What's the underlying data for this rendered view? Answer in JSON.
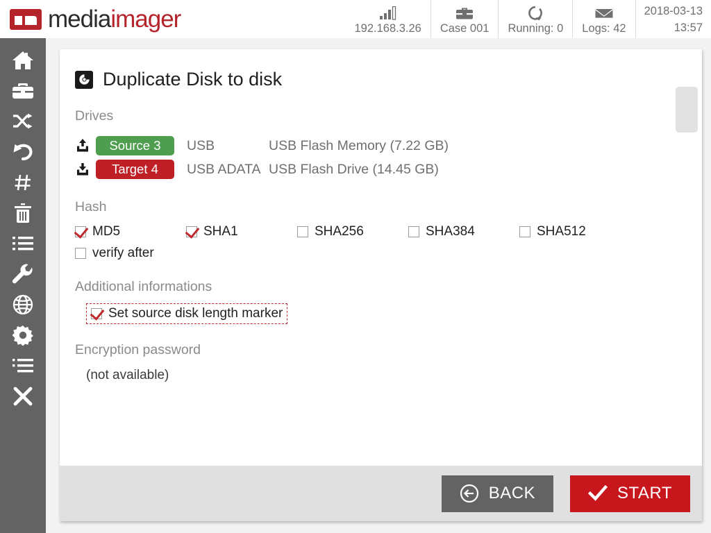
{
  "brand": {
    "name_part1": "media",
    "name_part2": "imager",
    "logo_red": "#b5232b"
  },
  "header": {
    "status": [
      {
        "icon": "signal-bars-icon",
        "label": "192.168.3.26"
      },
      {
        "icon": "briefcase-icon",
        "label": "Case 001"
      },
      {
        "icon": "refresh-icon",
        "label": "Running: 0"
      },
      {
        "icon": "envelope-icon",
        "label": "Logs: 42"
      }
    ],
    "date": "2018-03-13",
    "time": "13:57"
  },
  "sidebar": {
    "items": [
      {
        "icon": "home-icon",
        "name": "home"
      },
      {
        "icon": "briefcase-icon",
        "name": "cases"
      },
      {
        "icon": "shuffle-icon",
        "name": "duplicate"
      },
      {
        "icon": "undo-icon",
        "name": "restore"
      },
      {
        "icon": "hash-icon",
        "name": "hash"
      },
      {
        "icon": "trash-icon",
        "name": "wipe"
      },
      {
        "icon": "list-icon",
        "name": "logs"
      },
      {
        "icon": "wrench-icon",
        "name": "tools"
      },
      {
        "icon": "globe-icon",
        "name": "network"
      },
      {
        "icon": "gear-icon",
        "name": "settings"
      },
      {
        "icon": "indent-list-icon",
        "name": "tasks"
      },
      {
        "icon": "close-x-icon",
        "name": "close"
      }
    ]
  },
  "dialog": {
    "title": "Duplicate Disk to disk",
    "title_icon": "disk-icon",
    "drives_label": "Drives",
    "drives": [
      {
        "direction_icon": "upload-icon",
        "badge": "Source 3",
        "badge_color": "#4f9e4f",
        "bus": "USB",
        "description": "USB Flash Memory (7.22 GB)"
      },
      {
        "direction_icon": "download-icon",
        "badge": "Target 4",
        "badge_color": "#bf2026",
        "bus": "USB ADATA",
        "description": "USB Flash Drive (14.45 GB)"
      }
    ],
    "hash_label": "Hash",
    "hash_options": [
      {
        "label": "MD5",
        "checked": true
      },
      {
        "label": "SHA1",
        "checked": true
      },
      {
        "label": "SHA256",
        "checked": false
      },
      {
        "label": "SHA384",
        "checked": false
      },
      {
        "label": "SHA512",
        "checked": false
      }
    ],
    "verify_after": {
      "label": "verify after",
      "checked": false
    },
    "additional_label": "Additional informations",
    "additional_option": {
      "label": "Set source disk length marker",
      "checked": true,
      "focused": true
    },
    "encryption_label": "Encryption password",
    "encryption_value": "(not available)",
    "footer": {
      "back_label": "BACK",
      "back_icon": "arrow-left-circle-icon",
      "start_label": "START",
      "start_icon": "check-icon"
    }
  }
}
